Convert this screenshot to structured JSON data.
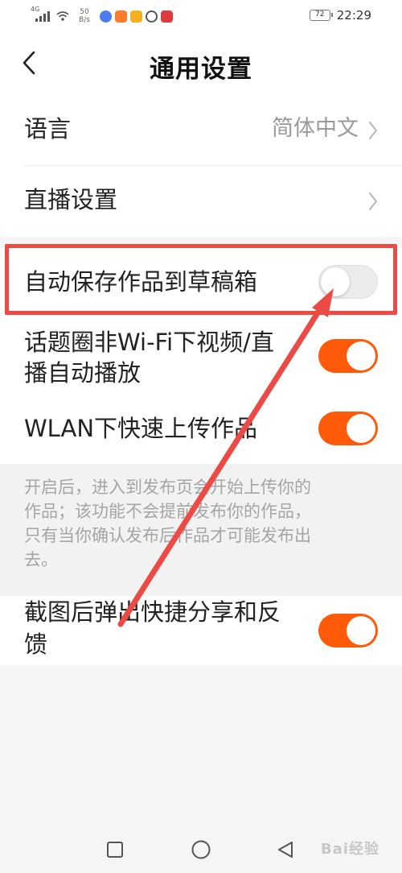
{
  "status_bar": {
    "network": "4G",
    "speed_value": "50",
    "speed_unit": "B/s",
    "battery": "72",
    "time": "22:29"
  },
  "header": {
    "title": "通用设置",
    "back_icon": "chevron-left-icon"
  },
  "settings": {
    "language": {
      "label": "语言",
      "value": "简体中文"
    },
    "live": {
      "label": "直播设置"
    },
    "auto_save": {
      "label": "自动保存作品到草稿箱",
      "enabled": false
    },
    "topic_autoplay": {
      "label_line1": "话题圈非Wi-Fi下视频/直",
      "label_line2": "播自动播放",
      "enabled": true
    },
    "wlan_upload": {
      "label": "WLAN下快速上传作品",
      "enabled": true
    },
    "wlan_note": {
      "line1": "开启后，进入到发布页会开始上传你的",
      "line2": "作品；该功能不会提前发布你的作品，",
      "line3": "只有当你确认发布后作品才可能发布出",
      "line4": "去。"
    },
    "screenshot_share": {
      "label_line1": "截图后弹出快捷分享和反",
      "label_line2": "馈",
      "enabled": true
    }
  },
  "colors": {
    "accent": "#ff5a0a",
    "highlight": "#ec4a45",
    "toggle_off": "#ececec"
  },
  "nav": {
    "recent_icon": "square-icon",
    "home_icon": "circle-icon",
    "back_icon": "triangle-back-icon"
  },
  "watermark": "Bai经验"
}
